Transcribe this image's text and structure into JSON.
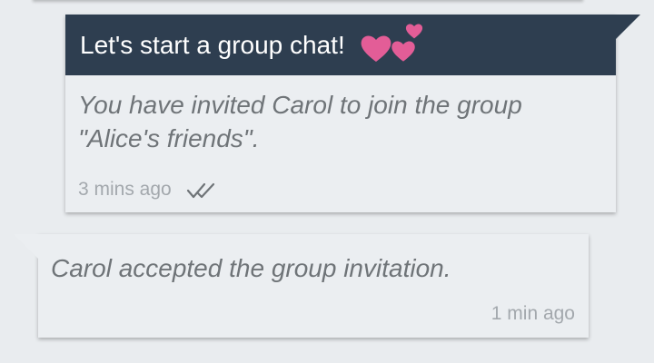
{
  "chat": {
    "messages": [
      {
        "direction": "outgoing",
        "header": "Let's start a group chat!",
        "header_icon": "hearts-icon",
        "text": "You have invited Carol to join the group \"Alice's friends\".",
        "time": "3 mins ago",
        "status_icon": "double-check-icon"
      },
      {
        "direction": "incoming",
        "text": "Carol accepted the group invitation.",
        "time": "1 min ago"
      }
    ]
  },
  "colors": {
    "background": "#e9ecef",
    "bubble": "#ebeef1",
    "header": "#2e3e50",
    "header_text": "#ffffff",
    "message_text": "#6f7478",
    "meta_text": "#a3a8ad",
    "hearts": "#e35d97"
  }
}
